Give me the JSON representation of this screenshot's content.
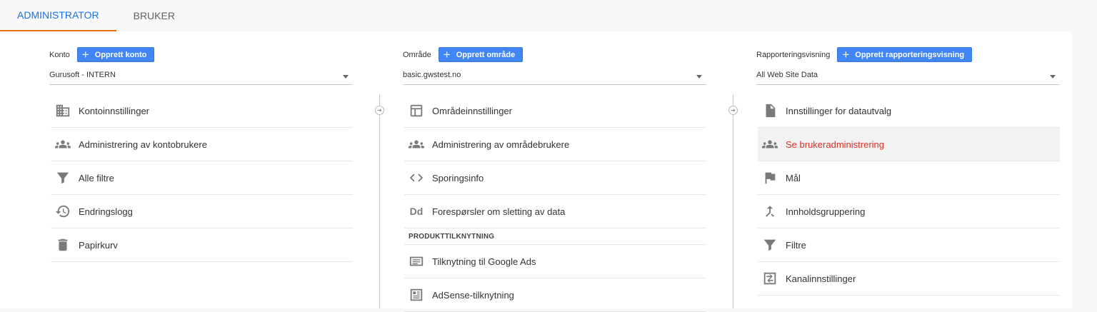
{
  "tabs": [
    {
      "label": "ADMINISTRATOR",
      "active": true
    },
    {
      "label": "BRUKER",
      "active": false
    }
  ],
  "columns": {
    "account": {
      "label": "Konto",
      "create_button": "Opprett konto",
      "selected": "Gurusoft - INTERN",
      "items": [
        {
          "label": "Kontoinnstillinger",
          "icon": "building-icon"
        },
        {
          "label": "Administrering av kontobrukere",
          "icon": "people-icon"
        },
        {
          "label": "Alle filtre",
          "icon": "filter-icon"
        },
        {
          "label": "Endringslogg",
          "icon": "history-icon"
        },
        {
          "label": "Papirkurv",
          "icon": "trash-icon"
        }
      ]
    },
    "property": {
      "label": "Område",
      "create_button": "Opprett område",
      "selected": "basic.gwstest.no",
      "items": [
        {
          "label": "Områdeinnstillinger",
          "icon": "layout-icon"
        },
        {
          "label": "Administrering av områdebrukere",
          "icon": "people-icon"
        },
        {
          "label": "Sporingsinfo",
          "icon": "code-icon"
        },
        {
          "label": "Forespørsler om sletting av data",
          "icon": "dd-icon"
        }
      ],
      "section_title": "PRODUKTTILKNYTNING",
      "section_items": [
        {
          "label": "Tilknytning til Google Ads",
          "icon": "ads-icon"
        },
        {
          "label": "AdSense-tilknytning",
          "icon": "adsense-icon"
        }
      ]
    },
    "view": {
      "label": "Rapporteringsvisning",
      "create_button": "Opprett rapporteringsvisning",
      "selected": "All Web Site Data",
      "items": [
        {
          "label": "Innstillinger for datautvalg",
          "icon": "file-icon"
        },
        {
          "label": "Se brukeradministrering",
          "icon": "people-icon",
          "selected": true
        },
        {
          "label": "Mål",
          "icon": "flag-icon"
        },
        {
          "label": "Innholdsgruppering",
          "icon": "merge-icon"
        },
        {
          "label": "Filtre",
          "icon": "filter-icon"
        },
        {
          "label": "Kanalinnstillinger",
          "icon": "channel-icon"
        }
      ]
    }
  },
  "colors": {
    "accent_blue": "#4285f4",
    "tab_active": "#1a73e8",
    "tab_underline": "#e8710a",
    "selected_text": "#d93025"
  }
}
